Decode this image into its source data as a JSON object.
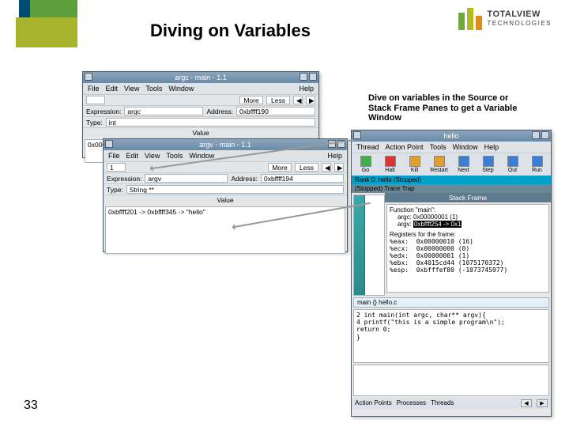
{
  "slide": {
    "title": "Diving on Variables",
    "page_number": "33",
    "caption": "Dive on variables in the Source or Stack Frame Panes to get a Variable Window"
  },
  "brand": {
    "line1": "TOTALVIEW",
    "line2": "TECHNOLOGIES"
  },
  "win1": {
    "title": "argc - main - 1.1",
    "help": "Help",
    "menu": [
      "File",
      "Edit",
      "View",
      "Tools",
      "Window"
    ],
    "btn_more": "More",
    "btn_less": "Less",
    "expression_lbl": "Expression:",
    "expression_val": "argc",
    "address_lbl": "Address:",
    "address_val": "0xbffff190",
    "type_lbl": "Type:",
    "type_val": "int",
    "value_hdr": "Value",
    "value_cell": "0x00000001 (1)",
    "nav_prev": "◀",
    "nav_next": "▶"
  },
  "win2": {
    "title": "argv - main - 1.1",
    "help": "Help",
    "menu": [
      "File",
      "Edit",
      "View",
      "Tools",
      "Window"
    ],
    "btn_more": "More",
    "btn_less": "Less",
    "nav_prev": "◀",
    "nav_next": "▶",
    "count_lbl": "",
    "count_val": "1",
    "expression_lbl": "Expression:",
    "expression_val": "argv",
    "address_lbl": "Address:",
    "address_val": "0xbffff194",
    "type_lbl": "Type:",
    "type_val": "String **",
    "value_hdr": "Value",
    "value_cell": "0xbffff201 -> 0xbffff345 -> \"hello\""
  },
  "win3": {
    "title": "hello",
    "menu": [
      "Thread",
      "Action Point",
      "Tools",
      "Window",
      "Help"
    ],
    "buttons": [
      {
        "label": "Go",
        "color": "#3db04a"
      },
      {
        "label": "Halt",
        "color": "#d33"
      },
      {
        "label": "Kill",
        "color": "#e0a030"
      },
      {
        "label": "Restart",
        "color": "#e0a030"
      },
      {
        "label": "Next",
        "color": "#3a7fd3"
      },
      {
        "label": "Step",
        "color": "#3a7fd3"
      },
      {
        "label": "Out",
        "color": "#3a7fd3"
      },
      {
        "label": "Run",
        "color": "#3a7fd3"
      }
    ],
    "status1": "Rank 0: hello (Stopped)",
    "status2": "(Stopped)   Trace Trap",
    "sf_title": "Stack Frame",
    "sf_func_lbl": "Function \"main\":",
    "sf_argc": "argc:   0x00000001 (1)",
    "sf_argv_a": "argv:   ",
    "sf_argv_b": "0xbffff254 -> 0x1",
    "sf_reg_header": "Registers for the frame:",
    "sf_regs": [
      "%eax:  0x00000010 (16)",
      "%ecx:  0x00000000 (0)",
      "%edx:  0x00000001 (1)",
      "%ebx:  0x4015cd44 (1075170372)",
      "%esp:  0xbfffef80 (-1073745977)"
    ],
    "main_line": "main {} hello.c",
    "src_lines": [
      "2  int main(int argc, char** argv){",
      "4    printf(\"this is a simple program\\n\");",
      "    return 0;",
      "  }"
    ],
    "tabs": [
      "Action Points",
      "Processes",
      "Threads"
    ],
    "nav_prev": "◀",
    "nav_next": "▶"
  }
}
